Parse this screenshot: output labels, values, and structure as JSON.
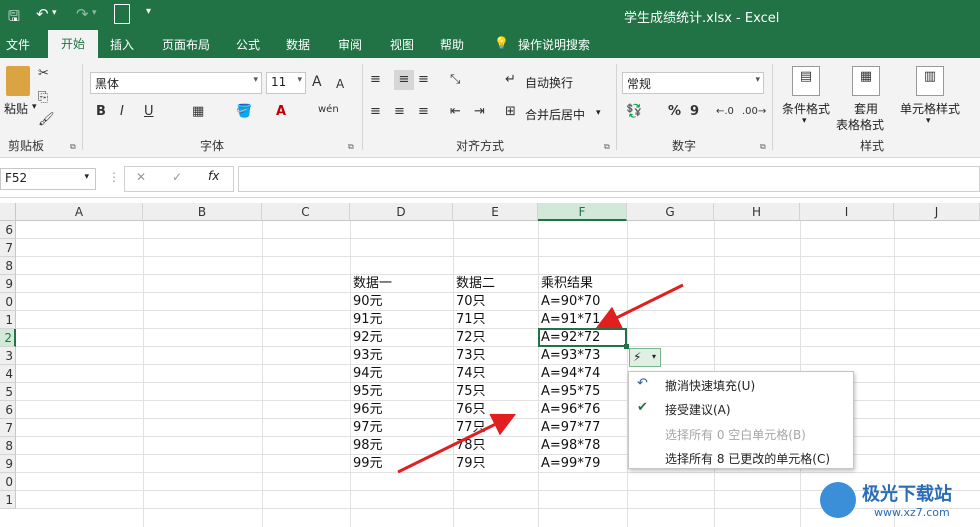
{
  "window": {
    "file_title": "学生成绩统计.xlsx",
    "separator": "-",
    "app": "Excel"
  },
  "quick_access": {
    "save": "💾",
    "undo": "↶",
    "redo": "↷",
    "preview": "🔍",
    "more": "▾"
  },
  "menu": {
    "tabs": [
      "文件",
      "开始",
      "插入",
      "页面布局",
      "公式",
      "数据",
      "审阅",
      "视图",
      "帮助"
    ],
    "tell_me": "操作说明搜索"
  },
  "ribbon": {
    "clipboard": {
      "paste": "粘贴",
      "group": "剪贴板"
    },
    "font": {
      "name": "黑体",
      "size": "11",
      "grow": "A",
      "shrink": "A",
      "bold": "B",
      "italic": "I",
      "underline": "U",
      "group": "字体"
    },
    "align": {
      "wrap": "自动换行",
      "merge": "合并后居中",
      "group": "对齐方式"
    },
    "number": {
      "format": "常规",
      "percent": "%",
      "comma": "9",
      "group": "数字"
    },
    "styles": {
      "cond": "条件格式",
      "table1": "套用",
      "table2": "表格格式",
      "cellstyle": "单元格样式",
      "group": "样式"
    }
  },
  "formula_bar": {
    "name_box": "F52",
    "cancel": "✕",
    "enter": "✓",
    "fx": "fx",
    "value": ""
  },
  "columns": [
    "A",
    "B",
    "C",
    "D",
    "E",
    "F",
    "G",
    "H",
    "I",
    "J"
  ],
  "rows": [
    "6",
    "7",
    "8",
    "9",
    "0",
    "1",
    "2",
    "3",
    "4",
    "5",
    "6",
    "7",
    "8",
    "9",
    "0",
    "1"
  ],
  "table": {
    "headers": [
      "数据一",
      "数据二",
      "乘积结果"
    ],
    "d": [
      "90元",
      "91元",
      "92元",
      "93元",
      "94元",
      "95元",
      "96元",
      "97元",
      "98元",
      "99元"
    ],
    "e": [
      "70只",
      "71只",
      "72只",
      "73只",
      "74只",
      "75只",
      "76只",
      "77只",
      "78只",
      "79只"
    ],
    "f": [
      "A=90*70",
      "A=91*71",
      "A=92*72",
      "A=93*73",
      "A=94*74",
      "A=95*75",
      "A=96*76",
      "A=97*77",
      "A=98*78",
      "A=99*79"
    ]
  },
  "flash_fill_menu": {
    "items": [
      "撤消快速填充(U)",
      "接受建议(A)",
      "选择所有 0 空白单元格(B)",
      "选择所有 8 已更改的单元格(C)"
    ]
  },
  "watermark": {
    "text": "极光下载站",
    "url": "www.xz7.com"
  }
}
